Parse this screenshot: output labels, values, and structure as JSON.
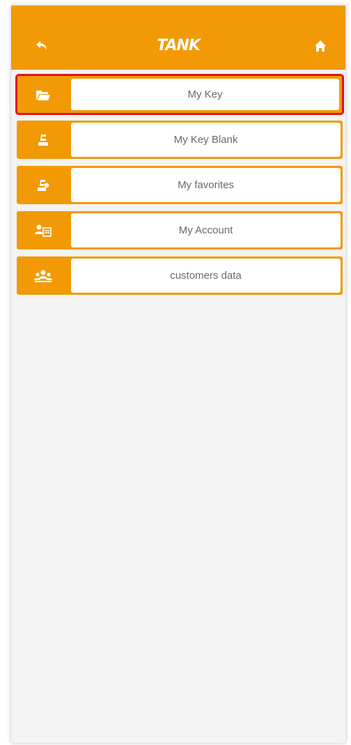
{
  "header": {
    "title": "TANK",
    "back_icon": "back-arrow-icon",
    "home_icon": "home-icon",
    "background": "#f29a05"
  },
  "menu": {
    "items": [
      {
        "label": "My Key",
        "icon": "folder-icon",
        "selected": true
      },
      {
        "label": "My Key Blank",
        "icon": "key-machine-icon",
        "selected": false
      },
      {
        "label": "My favorites",
        "icon": "favorite-machine-icon",
        "selected": false
      },
      {
        "label": "My Account",
        "icon": "account-card-icon",
        "selected": false
      },
      {
        "label": "customers data",
        "icon": "customers-group-icon",
        "selected": false
      }
    ]
  },
  "colors": {
    "accent": "#f29a05",
    "selection_border": "#e0141b",
    "label_text": "#6a6a6a",
    "background": "#f3f3f3"
  }
}
